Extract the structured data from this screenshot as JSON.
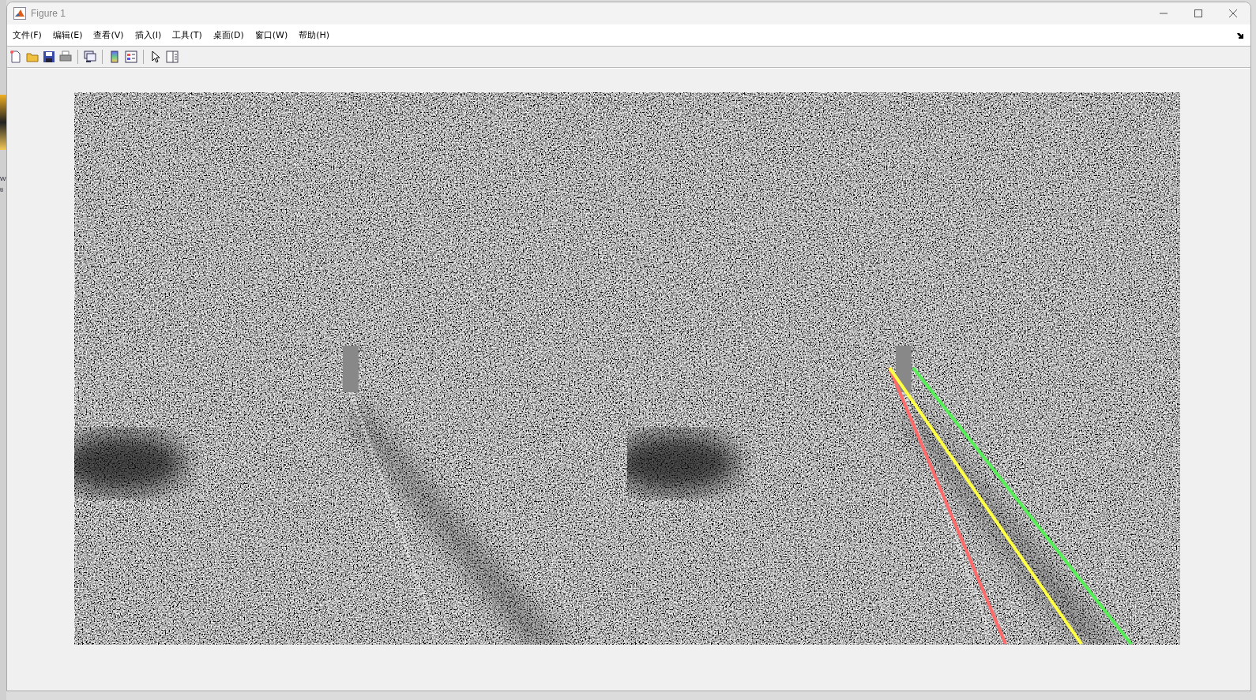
{
  "background_window": {
    "text_fragments": [
      "W",
      "ti"
    ]
  },
  "window": {
    "title": "Figure 1"
  },
  "menu": [
    "文件(F)",
    "编辑(E)",
    "查看(V)",
    "插入(I)",
    "工具(T)",
    "桌面(D)",
    "窗口(W)",
    "帮助(H)"
  ],
  "image": {
    "overlay_lines": [
      {
        "color": "#ff6b6b"
      },
      {
        "color": "#ffff44"
      },
      {
        "color": "#55ee55"
      }
    ]
  }
}
